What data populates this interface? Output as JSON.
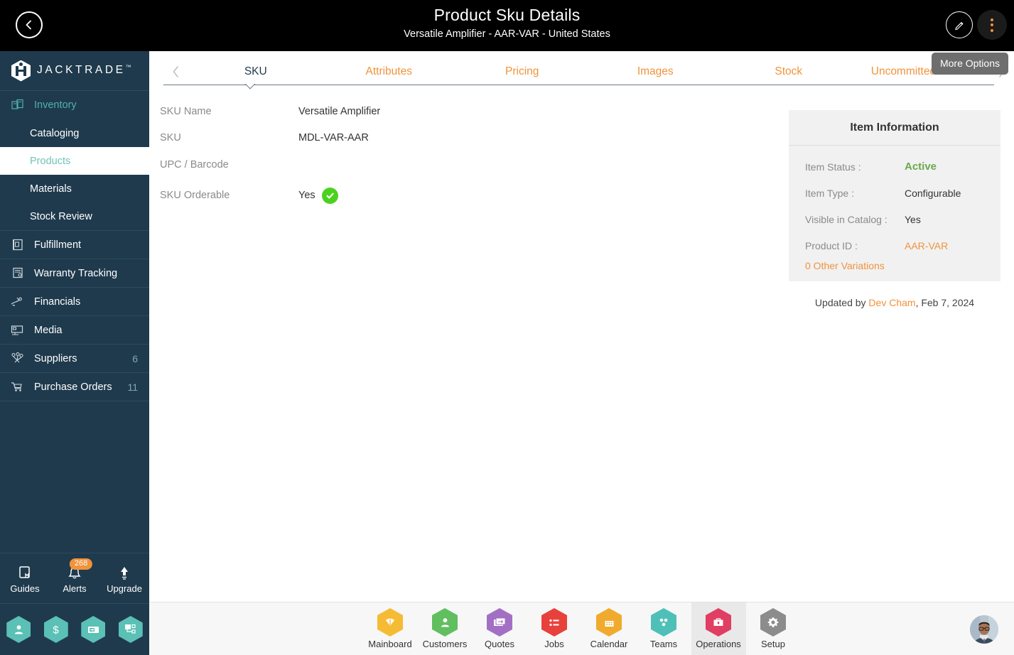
{
  "header": {
    "title": "Product Sku Details",
    "subtitle": "Versatile Amplifier - AAR-VAR - United States",
    "back_icon": "chevron-left-icon",
    "edit_icon": "pencil-icon",
    "more_icon": "kebab-menu-icon",
    "tooltip": "More Options"
  },
  "brand": {
    "name": "JACKTRADE",
    "tm": "™"
  },
  "sidebar": {
    "group": {
      "label": "Inventory",
      "icon": "inventory-icon"
    },
    "sub_items": [
      {
        "label": "Cataloging",
        "active": false
      },
      {
        "label": "Products",
        "active": true
      },
      {
        "label": "Materials",
        "active": false
      },
      {
        "label": "Stock Review",
        "active": false
      }
    ],
    "items": [
      {
        "label": "Fulfillment",
        "icon": "fulfillment-icon",
        "count": ""
      },
      {
        "label": "Warranty Tracking",
        "icon": "warranty-icon",
        "count": ""
      },
      {
        "label": "Financials",
        "icon": "financials-icon",
        "count": ""
      },
      {
        "label": "Media",
        "icon": "media-icon",
        "count": ""
      },
      {
        "label": "Suppliers",
        "icon": "suppliers-icon",
        "count": "6"
      },
      {
        "label": "Purchase Orders",
        "icon": "purchase-orders-icon",
        "count": "11"
      }
    ],
    "bottom_tools": [
      {
        "label": "Guides",
        "icon": "book-icon",
        "badge": ""
      },
      {
        "label": "Alerts",
        "icon": "bell-icon",
        "badge": "268"
      },
      {
        "label": "Upgrade",
        "icon": "up-arrow-icon",
        "badge": ""
      }
    ],
    "quick_hexes": [
      {
        "icon": "user-icon"
      },
      {
        "icon": "dollar-icon"
      },
      {
        "icon": "payment-icon"
      },
      {
        "icon": "workflow-icon"
      }
    ]
  },
  "tabs": {
    "prev_icon": "chevron-left-icon",
    "next_icon": "chevron-right-icon",
    "items": [
      {
        "label": "SKU",
        "active": true
      },
      {
        "label": "Attributes",
        "active": false
      },
      {
        "label": "Pricing",
        "active": false
      },
      {
        "label": "Images",
        "active": false
      },
      {
        "label": "Stock",
        "active": false
      },
      {
        "label": "Uncommitted Serials",
        "active": false
      }
    ]
  },
  "sku_fields": [
    {
      "label": "SKU Name",
      "value": "Versatile Amplifier",
      "check": false
    },
    {
      "label": "SKU",
      "value": "MDL-VAR-AAR",
      "check": false
    },
    {
      "label": "UPC / Barcode",
      "value": "",
      "check": false
    },
    {
      "label": "SKU Orderable",
      "value": "Yes",
      "check": true
    }
  ],
  "item_information": {
    "title": "Item Information",
    "rows": [
      {
        "key": "Item Status :",
        "value": "Active",
        "style": "green"
      },
      {
        "key": "Item Type :",
        "value": "Configurable",
        "style": "plain"
      },
      {
        "key": "Visible in Catalog :",
        "value": "Yes",
        "style": "plain"
      },
      {
        "key": "Product ID :",
        "value": "AAR-VAR",
        "style": "orange"
      }
    ],
    "variations_link": "0 Other Variations",
    "updated_prefix": "Updated by ",
    "updated_user": "Dev Cham",
    "updated_suffix": ", Feb 7, 2024"
  },
  "bottom_apps": [
    {
      "label": "Mainboard",
      "icon": "mainboard-icon",
      "color": "#f5bb34",
      "active": false
    },
    {
      "label": "Customers",
      "icon": "customers-icon",
      "color": "#61bf5f",
      "active": false
    },
    {
      "label": "Quotes",
      "icon": "quotes-icon",
      "color": "#a26fc4",
      "active": false
    },
    {
      "label": "Jobs",
      "icon": "jobs-icon",
      "color": "#e8413c",
      "active": false
    },
    {
      "label": "Calendar",
      "icon": "calendar-icon",
      "color": "#f0ab2e",
      "active": false
    },
    {
      "label": "Teams",
      "icon": "teams-icon",
      "color": "#4fc0b8",
      "active": false
    },
    {
      "label": "Operations",
      "icon": "operations-icon",
      "color": "#e03e62",
      "active": true
    },
    {
      "label": "Setup",
      "icon": "setup-gear-icon",
      "color": "#8c8c8c",
      "active": false
    }
  ],
  "colors": {
    "accent_orange": "#f0933b",
    "sidebar_navy": "#1f3a4d",
    "teal": "#4fb3a8",
    "status_green": "#6aa84f"
  }
}
